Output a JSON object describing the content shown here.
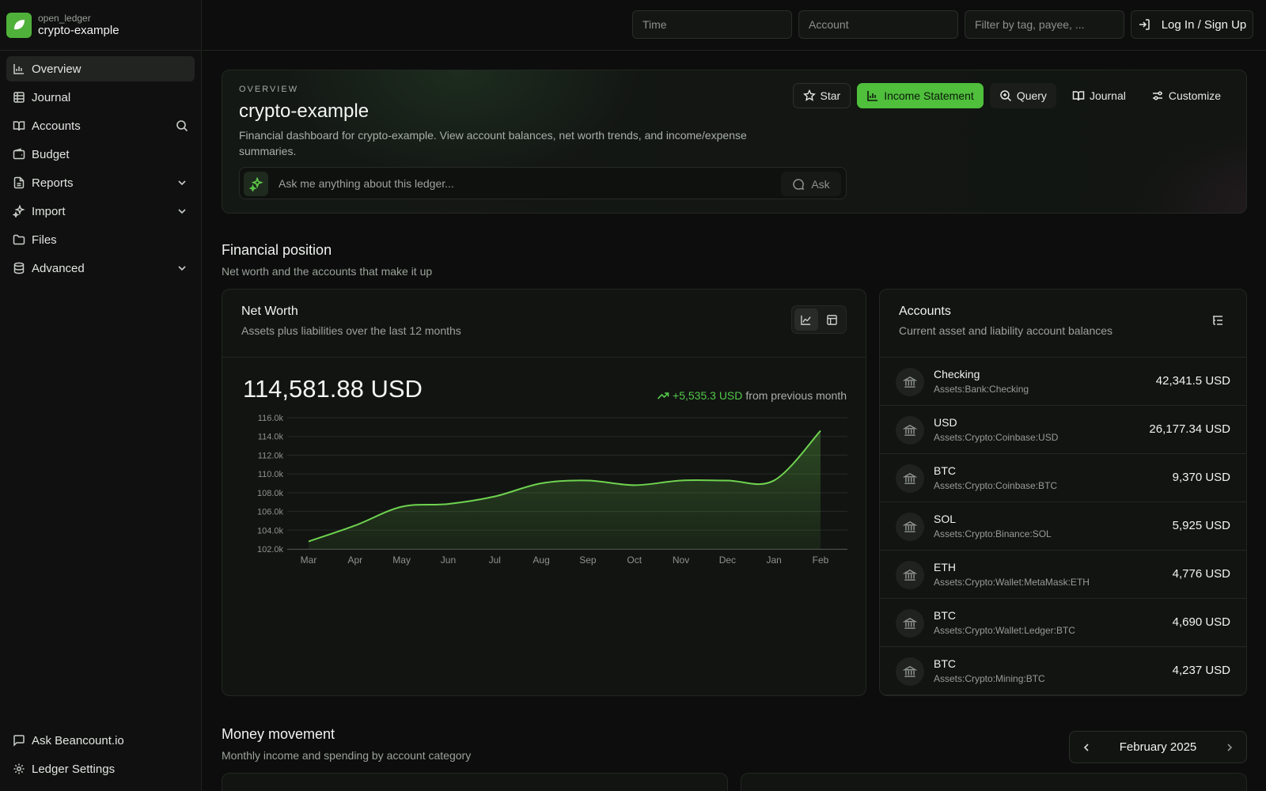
{
  "brand": {
    "org": "open_ledger",
    "name": "crypto-example"
  },
  "sidebar": {
    "items": [
      {
        "label": "Overview",
        "icon": "bar-chart-icon",
        "active": true
      },
      {
        "label": "Journal",
        "icon": "table-icon"
      },
      {
        "label": "Accounts",
        "icon": "book-icon",
        "trailing": "search-icon"
      },
      {
        "label": "Budget",
        "icon": "wallet-icon"
      },
      {
        "label": "Reports",
        "icon": "file-text-icon",
        "trailing": "chevron-down-icon"
      },
      {
        "label": "Import",
        "icon": "sparkles-icon",
        "trailing": "chevron-down-icon"
      },
      {
        "label": "Files",
        "icon": "folder-icon"
      },
      {
        "label": "Advanced",
        "icon": "database-icon",
        "trailing": "chevron-down-icon"
      }
    ],
    "bottom": [
      {
        "label": "Ask Beancount.io",
        "icon": "message-square-icon"
      },
      {
        "label": "Ledger Settings",
        "icon": "gear-icon"
      }
    ]
  },
  "topbar": {
    "time_placeholder": "Time",
    "account_placeholder": "Account",
    "filter_placeholder": "Filter by tag, payee, ...",
    "login_label": "Log In / Sign Up"
  },
  "hero": {
    "eyebrow": "OVERVIEW",
    "title": "crypto-example",
    "description": "Financial dashboard for crypto-example. View account balances, net worth trends, and income/expense summaries.",
    "ask_placeholder": "Ask me anything about this ledger...",
    "ask_button": "Ask",
    "actions": {
      "star": "Star",
      "income_statement": "Income Statement",
      "query": "Query",
      "journal": "Journal",
      "customize": "Customize"
    }
  },
  "financial_position": {
    "title": "Financial position",
    "subtitle": "Net worth and the accounts that make it up"
  },
  "net_worth": {
    "title": "Net Worth",
    "subtitle": "Assets plus liabilities over the last 12 months",
    "value": "114,581.88 USD",
    "change": "+5,535.3 USD",
    "change_suffix": "from previous month"
  },
  "chart_data": {
    "type": "area",
    "categories": [
      "Mar",
      "Apr",
      "May",
      "Jun",
      "Jul",
      "Aug",
      "Sep",
      "Oct",
      "Nov",
      "Dec",
      "Jan",
      "Feb"
    ],
    "series": [
      {
        "values": [
          102.8,
          104.5,
          106.5,
          106.8,
          107.6,
          109.0,
          109.3,
          108.8,
          109.3,
          109.3,
          109.3,
          114.6
        ]
      }
    ],
    "y_ticks": [
      "102.0k",
      "104.0k",
      "106.0k",
      "108.0k",
      "110.0k",
      "112.0k",
      "114.0k",
      "116.0k"
    ],
    "ylim": [
      102,
      116
    ],
    "grid": true,
    "color": "#6fd34f"
  },
  "accounts": {
    "title": "Accounts",
    "subtitle": "Current asset and liability account balances",
    "rows": [
      {
        "name": "Checking",
        "path": "Assets:Bank:Checking",
        "balance": "42,341.5 USD"
      },
      {
        "name": "USD",
        "path": "Assets:Crypto:Coinbase:USD",
        "balance": "26,177.34 USD"
      },
      {
        "name": "BTC",
        "path": "Assets:Crypto:Coinbase:BTC",
        "balance": "9,370 USD"
      },
      {
        "name": "SOL",
        "path": "Assets:Crypto:Binance:SOL",
        "balance": "5,925 USD"
      },
      {
        "name": "ETH",
        "path": "Assets:Crypto:Wallet:MetaMask:ETH",
        "balance": "4,776 USD"
      },
      {
        "name": "BTC",
        "path": "Assets:Crypto:Wallet:Ledger:BTC",
        "balance": "4,690 USD"
      },
      {
        "name": "BTC",
        "path": "Assets:Crypto:Mining:BTC",
        "balance": "4,237 USD"
      }
    ]
  },
  "money_movement": {
    "title": "Money movement",
    "subtitle": "Monthly income and spending by account category",
    "month": "February 2025"
  },
  "colors": {
    "accent": "#4fbf3c",
    "positive": "#52c94a",
    "background": "#0c0d0c"
  }
}
